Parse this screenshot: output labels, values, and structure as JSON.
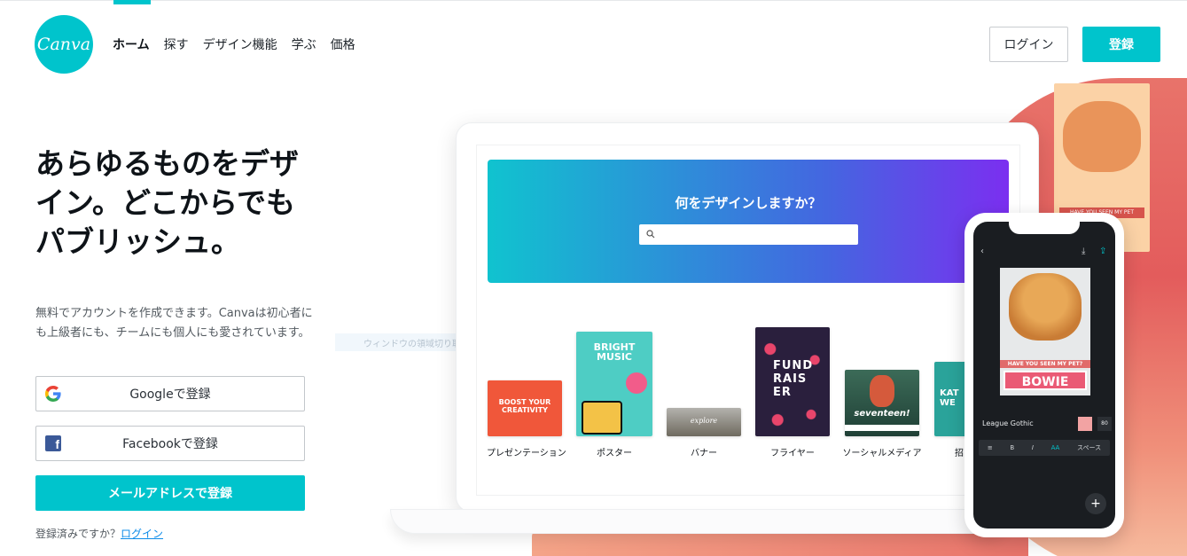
{
  "brand": {
    "logo_text": "Canva",
    "accent": "#00c4cc"
  },
  "nav": {
    "items": [
      {
        "label": "ホーム",
        "active": true
      },
      {
        "label": "探す"
      },
      {
        "label": "デザイン機能"
      },
      {
        "label": "学ぶ"
      },
      {
        "label": "価格"
      }
    ]
  },
  "header": {
    "login_label": "ログイン",
    "signup_label": "登録"
  },
  "hero": {
    "title": "あらゆるものをデザイン。どこからでもパブリッシュ。",
    "description": "無料でアカウントを作成できます。Canvaは初心者にも上級者にも、チームにも個人にも愛されています。",
    "google_label": "Googleで登録",
    "facebook_label": "Facebookで登録",
    "email_label": "メールアドレスで登録",
    "already_text": "登録済みですか？",
    "already_link": "ログイン"
  },
  "ghost_tooltip": "ウィンドウの領域切り取り(W)",
  "laptop": {
    "question": "何をデザインしますか？",
    "templates": [
      {
        "label": "プレゼンテーション",
        "thumb_text": "BOOST YOUR CREATIVITY"
      },
      {
        "label": "ポスター",
        "thumb_text": "BRIGHT MUSIC"
      },
      {
        "label": "バナー",
        "thumb_text": "explore"
      },
      {
        "label": "フライヤー",
        "thumb_text": "FUND RAIS ER"
      },
      {
        "label": "ソーシャルメディア",
        "thumb_text": "seventeen!"
      },
      {
        "label": "招",
        "thumb_text": "KAT WE"
      }
    ]
  },
  "phone": {
    "poster_sub": "HAVE YOU SEEN MY PET?",
    "poster_name": "BOWIE",
    "font_name": "League Gothic",
    "font_size": "80",
    "tool_aa": "AA",
    "tool_space": "スペース",
    "fab": "+"
  },
  "bg_card": {
    "banner": "HAVE YOU SEEN MY PET"
  }
}
